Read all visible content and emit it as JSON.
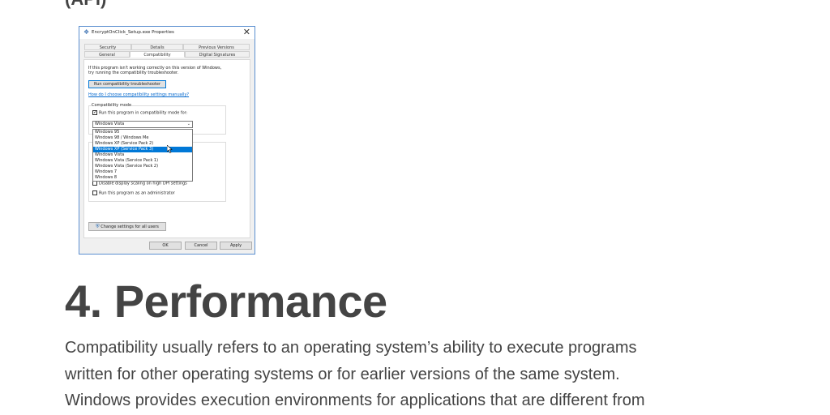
{
  "top_fragment": "(API)",
  "dialog": {
    "title": "EncryptOnClick_Setup.exe Properties",
    "close": "✕",
    "tabs_row1": [
      "Security",
      "Details",
      "Previous Versions"
    ],
    "tabs_row2": [
      "General",
      "Compatibility",
      "Digital Signatures"
    ],
    "intro_line1": "If this program isn't working correctly on this version of Windows,",
    "intro_line2": "try running the compatibility troubleshooter.",
    "troubleshooter_button": "Run compatibility troubleshooter",
    "manual_link": "How do I choose compatibility settings manually?",
    "compat_mode_label": "Compatibility mode",
    "compat_checkbox": "Run this program in compatibility mode for:",
    "compat_checked": true,
    "selected_value": "Windows Vista",
    "options": [
      "Windows 95",
      "Windows 98 / Windows Me",
      "Windows XP (Service Pack 2)",
      "Windows XP (Service Pack 3)",
      "Windows Vista",
      "Windows Vista (Service Pack 1)",
      "Windows Vista (Service Pack 2)",
      "Windows 7",
      "Windows 8"
    ],
    "highlighted_option_index": 3,
    "dpi_checkbox": "Disable display scaling on high DPI settings",
    "admin_checkbox": "Run this program as an administrator",
    "change_settings_button": "Change settings for all users",
    "ok_button": "OK",
    "cancel_button": "Cancel",
    "apply_button": "Apply",
    "accent_color": "#0078d7"
  },
  "article": {
    "heading": "4. Performance",
    "paragraph_lines": [
      "Compatibility usually refers to an operating system’s ability to execute programs",
      "written for other operating systems or for earlier versions of the same system.",
      "Windows provides execution environments for applications that are different from"
    ]
  }
}
